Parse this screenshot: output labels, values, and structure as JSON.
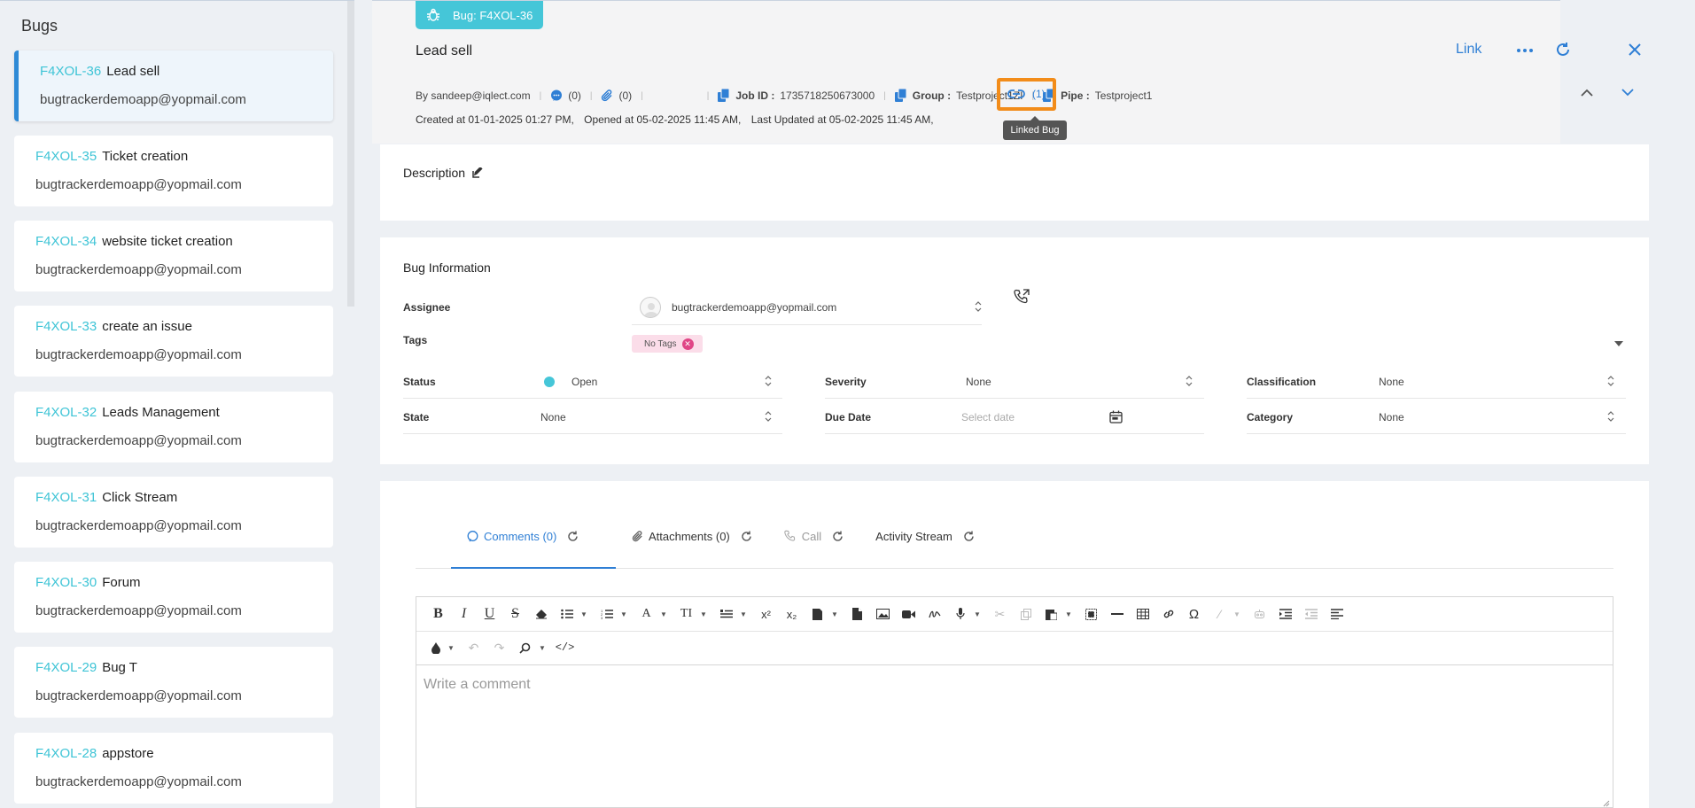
{
  "sidebar": {
    "title": "Bugs",
    "bugs": [
      {
        "id": "F4XOL-36",
        "name": "Lead sell",
        "email": "bugtrackerdemoapp@yopmail.com",
        "active": true
      },
      {
        "id": "F4XOL-35",
        "name": "Ticket creation",
        "email": "bugtrackerdemoapp@yopmail.com"
      },
      {
        "id": "F4XOL-34",
        "name": "website ticket creation",
        "email": "bugtrackerdemoapp@yopmail.com"
      },
      {
        "id": "F4XOL-33",
        "name": "create an issue",
        "email": "bugtrackerdemoapp@yopmail.com"
      },
      {
        "id": "F4XOL-32",
        "name": "Leads Management",
        "email": "bugtrackerdemoapp@yopmail.com"
      },
      {
        "id": "F4XOL-31",
        "name": "Click Stream",
        "email": "bugtrackerdemoapp@yopmail.com"
      },
      {
        "id": "F4XOL-30",
        "name": "Forum",
        "email": "bugtrackerdemoapp@yopmail.com"
      },
      {
        "id": "F4XOL-29",
        "name": "Bug T",
        "email": "bugtrackerdemoapp@yopmail.com"
      },
      {
        "id": "F4XOL-28",
        "name": "appstore",
        "email": "bugtrackerdemoapp@yopmail.com"
      }
    ]
  },
  "detail": {
    "chip": "Bug: F4XOL-36",
    "title": "Lead sell",
    "link_label": "Link",
    "by": "By sandeep@iqlect.com",
    "comments_count": "(0)",
    "attachments_count": "(0)",
    "linked_count": "(1)",
    "linked_tooltip": "Linked Bug",
    "job_label": "Job ID :",
    "job_value": "1735718250673000",
    "group_label": "Group :",
    "group_value": "Testproject1ZI",
    "pipe_label": "Pipe :",
    "pipe_value": "Testproject1",
    "created": "Created at 01-01-2025 01:27 PM,",
    "opened": "Opened at 05-02-2025 11:45 AM,",
    "updated": "Last Updated at 05-02-2025 11:45 AM,"
  },
  "description": {
    "label": "Description"
  },
  "info": {
    "title": "Bug Information",
    "assignee_label": "Assignee",
    "assignee_value": "bugtrackerdemoapp@yopmail.com",
    "tags_label": "Tags",
    "tags_value": "No Tags",
    "status_label": "Status",
    "status_value": "Open",
    "severity_label": "Severity",
    "severity_value": "None",
    "classification_label": "Classification",
    "classification_value": "None",
    "state_label": "State",
    "state_value": "None",
    "due_label": "Due Date",
    "due_placeholder": "Select date",
    "category_label": "Category",
    "category_value": "None"
  },
  "comments": {
    "tabs": [
      "Comments (0)",
      "Attachments (0)",
      "Call",
      "Activity Stream"
    ],
    "placeholder": "Write a comment"
  },
  "colors": {
    "accent": "#2f7fd5",
    "teal": "#45c6d8",
    "highlight": "#f28c1a",
    "tag": "#fbdde9"
  }
}
